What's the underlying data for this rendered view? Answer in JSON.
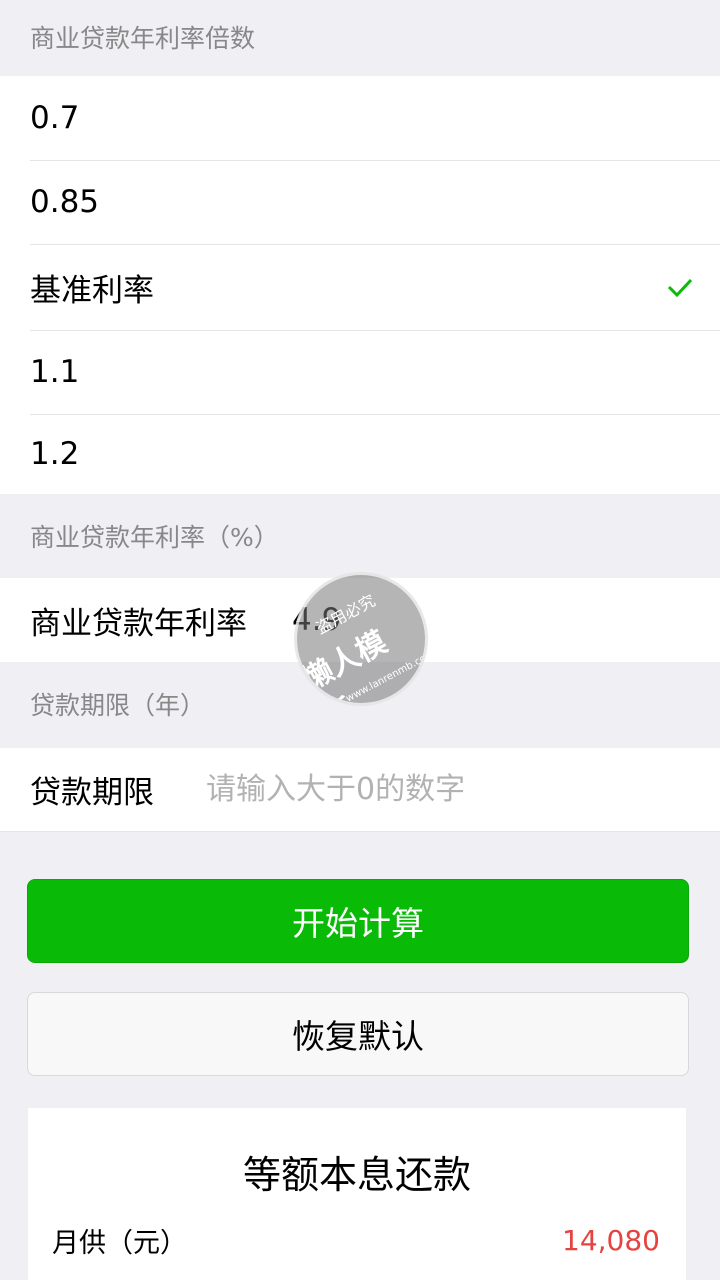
{
  "rate_multiplier": {
    "header": "商业贷款年利率倍数",
    "options": [
      {
        "label": "0.7",
        "selected": false
      },
      {
        "label": "0.85",
        "selected": false
      },
      {
        "label": "基准利率",
        "selected": true
      },
      {
        "label": "1.1",
        "selected": false
      },
      {
        "label": "1.2",
        "selected": false
      }
    ]
  },
  "annual_rate": {
    "header": "商业贷款年利率（%）",
    "label": "商业贷款年利率",
    "value": "4.9"
  },
  "loan_term": {
    "header": "贷款期限（年）",
    "label": "贷款期限",
    "placeholder": "请输入大于0的数字"
  },
  "buttons": {
    "calculate": "开始计算",
    "reset": "恢复默认"
  },
  "result": {
    "title": "等额本息还款",
    "monthly_label": "月供（元）",
    "monthly_value": "14,080"
  },
  "watermark": {
    "top": "盗用必究",
    "main": "懒人模板",
    "url": "www.lanrenmb.com"
  },
  "colors": {
    "accent_green": "#09bb07",
    "amount_red": "#e64340",
    "check_green": "#09bb07"
  }
}
